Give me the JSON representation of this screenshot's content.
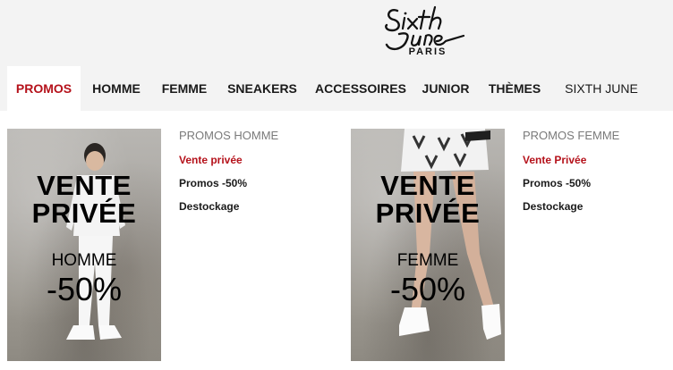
{
  "brand": {
    "city": "PARIS"
  },
  "nav": {
    "tabs": [
      "PROMOS",
      "HOMME",
      "FEMME",
      "SNEAKERS",
      "ACCESSOIRES",
      "JUNIOR",
      "THÈMES",
      "SIXTH JUNE"
    ],
    "active_index": 0
  },
  "promo_homme": {
    "banner": {
      "line1": "VENTE",
      "line2": "PRIVÉE",
      "gender": "HOMME",
      "discount": "-50%"
    },
    "category": "PROMOS HOMME",
    "links": [
      "Vente privée",
      "Promos -50%",
      "Destockage"
    ]
  },
  "promo_femme": {
    "banner": {
      "line1": "VENTE",
      "line2": "PRIVÉE",
      "gender": "FEMME",
      "discount": "-50%"
    },
    "category": "PROMOS FEMME",
    "links": [
      "Vente Privée",
      "Promos -50%",
      "Destockage"
    ]
  },
  "colors": {
    "accent": "#b5121b",
    "header_bg": "#f3f3f3",
    "muted": "#7a7a7a"
  }
}
